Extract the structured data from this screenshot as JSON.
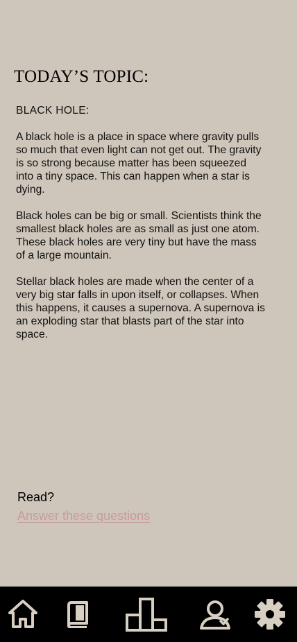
{
  "header": {
    "title": "TODAY’S TOPIC:"
  },
  "article": {
    "subtitle": "BLACK HOLE:",
    "paragraphs": [
      "A black hole is a place in space where gravity pulls so much that even light can not get out. The gravity is so strong because matter has been squeezed into a tiny space. This can happen when a star is dying.",
      "Black holes can be big or small. Scientists think the smallest black holes are as small as just one atom. These black holes are very tiny but have the mass of a large mountain.",
      "Stellar black holes are made when the center of a very big star falls in upon itself, or collapses. When this happens, it causes a supernova. A supernova is an exploding star that blasts part of the star into space."
    ]
  },
  "quiz": {
    "prompt": "Read?",
    "link_label": "Answer these questions"
  },
  "nav": {
    "items": [
      {
        "icon": "home-icon"
      },
      {
        "icon": "book-icon"
      },
      {
        "icon": "podium-icon"
      },
      {
        "icon": "profile-icon"
      },
      {
        "icon": "gear-icon"
      }
    ]
  },
  "colors": {
    "background": "#cec6ba",
    "nav_background": "#000000",
    "nav_icon": "#d8cfc3",
    "link": "#c79a9e"
  }
}
